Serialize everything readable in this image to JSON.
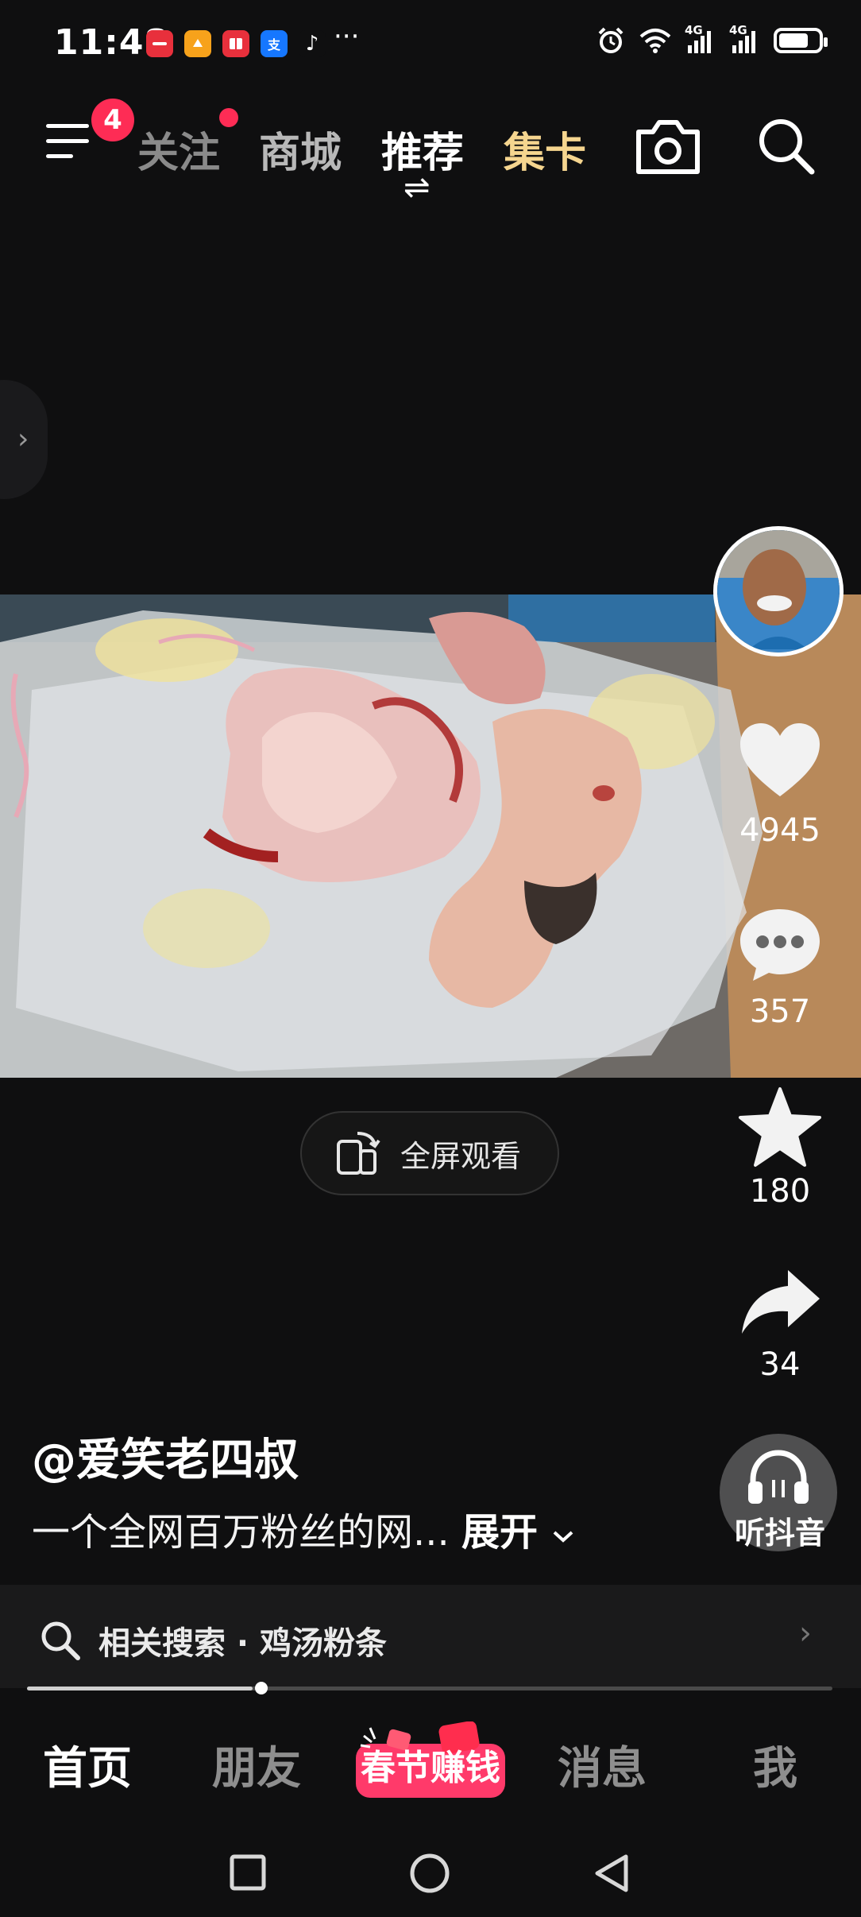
{
  "status_bar": {
    "time": "11:48",
    "more_dots": "···",
    "apps": [
      {
        "icon": "huawei-app-icon",
        "color": "#e8303c"
      },
      {
        "icon": "orange-app-icon",
        "color": "#f7a21b"
      },
      {
        "icon": "red-book-app-icon",
        "color": "#e8303c"
      },
      {
        "icon": "alipay-app-icon",
        "color": "#1677ff",
        "glyph": "支"
      },
      {
        "icon": "tiktok-app-icon",
        "color": "#0f0f10",
        "glyph": "♪"
      }
    ],
    "network_1": "4G",
    "network_2": "4G",
    "battery_level": 0.78
  },
  "top_nav": {
    "menu_badge": "4",
    "tabs": [
      {
        "label": "关注"
      },
      {
        "label": "商城"
      },
      {
        "label": "推荐"
      },
      {
        "label": "集卡"
      }
    ],
    "switch_glyph": "⇌"
  },
  "side_handle_glyph": "›",
  "actions": {
    "likes": "4945",
    "comments": "357",
    "favorites": "180",
    "shares": "34"
  },
  "fullscreen_label": "全屏观看",
  "post": {
    "author": "@爱笑老四叔",
    "description": "一个全网百万粉丝的网...",
    "expand_label": "展开"
  },
  "listen_label": "听抖音",
  "related_search": {
    "text": "相关搜索 · 鸡汤粉条",
    "arrow": "›"
  },
  "video_progress": 0.28,
  "bottom_nav": {
    "home": "首页",
    "friends": "朋友",
    "promo": "春节赚钱",
    "messages": "消息",
    "me": "我"
  },
  "colors": {
    "accent_red": "#fe2c55",
    "gold_tab": "#f5d58f",
    "background": "#0f0f10"
  }
}
